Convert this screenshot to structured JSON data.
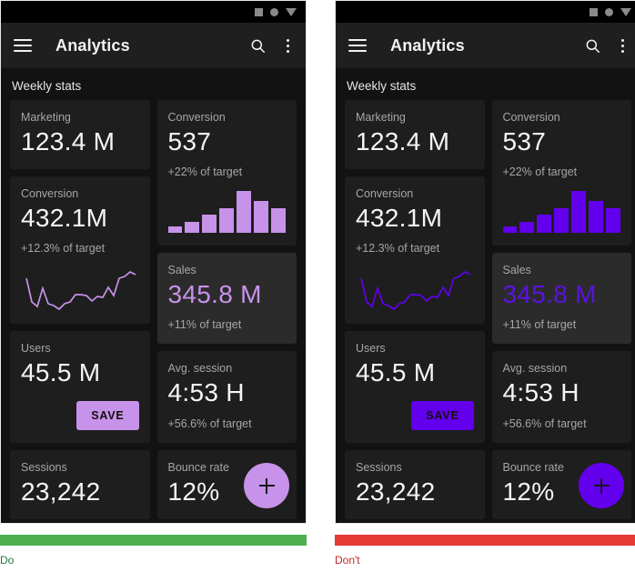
{
  "accents": {
    "do": "#c792ea",
    "dont": "#6200ee",
    "do_bar": "#4caf50",
    "dont_bar": "#e53935"
  },
  "statusbar": {
    "icons": [
      "square-icon",
      "circle-icon",
      "triangle-down-icon"
    ]
  },
  "appbar": {
    "menu_icon": "hamburger-menu-icon",
    "title": "Analytics",
    "search_icon": "search-icon",
    "overflow_icon": "more-vert-icon"
  },
  "section": {
    "title": "Weekly stats"
  },
  "cards": {
    "marketing": {
      "label": "Marketing",
      "value": "123.4 M"
    },
    "conversion_a": {
      "label": "Conversion",
      "value": "537",
      "sub": "+22% of target"
    },
    "conversion_b": {
      "label": "Conversion",
      "value": "432.1M",
      "sub": "+12.3% of target"
    },
    "sales": {
      "label": "Sales",
      "value": "345.8 M",
      "sub": "+11% of target"
    },
    "users": {
      "label": "Users",
      "value": "45.5 M",
      "button": "SAVE"
    },
    "avg_session": {
      "label": "Avg. session",
      "value": "4:53 H",
      "sub": "+56.6% of target"
    },
    "sessions": {
      "label": "Sessions",
      "value": "23,242"
    },
    "bounce_rate": {
      "label": "Bounce rate",
      "value": "12%"
    }
  },
  "fab": {
    "icon": "plus-icon"
  },
  "chart_data": [
    {
      "type": "bar",
      "title": "Conversion weekly bars",
      "categories": [
        "1",
        "2",
        "3",
        "4",
        "5",
        "6",
        "7"
      ],
      "values": [
        14,
        26,
        42,
        56,
        96,
        74,
        56
      ],
      "ylim": [
        0,
        100
      ],
      "xlabel": "",
      "ylabel": "",
      "grid": false,
      "legend": "none"
    },
    {
      "type": "line",
      "title": "Conversion sparkline",
      "x": [
        0,
        1,
        2,
        3,
        4,
        5,
        6,
        7,
        8,
        9,
        10,
        11,
        12,
        13,
        14,
        15,
        16,
        17,
        18,
        19,
        20
      ],
      "values": [
        62,
        20,
        10,
        40,
        16,
        12,
        6,
        14,
        18,
        36,
        36,
        34,
        22,
        32,
        30,
        52,
        34,
        62,
        66,
        76,
        70
      ],
      "ylim": [
        0,
        100
      ],
      "xlabel": "",
      "ylabel": "",
      "grid": false,
      "legend": "none"
    }
  ],
  "annotations": {
    "do": {
      "caption": "Do"
    },
    "dont": {
      "caption": "Don't"
    }
  }
}
